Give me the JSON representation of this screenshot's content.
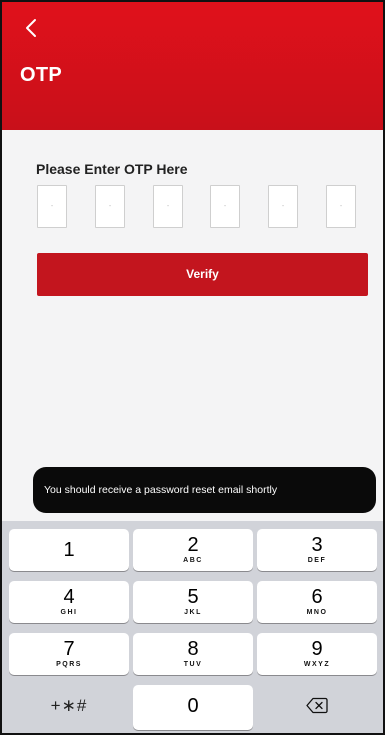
{
  "header": {
    "title": "OTP",
    "back_icon": "chevron-left-icon",
    "color": "#d4111b"
  },
  "otp": {
    "label": "Please Enter OTP Here",
    "digits": [
      "-",
      "-",
      "-",
      "-",
      "-",
      "-"
    ]
  },
  "verify": {
    "label": "Verify",
    "color": "#c3151e"
  },
  "toast": {
    "message": "You should receive a password reset email shortly"
  },
  "keypad": {
    "keys": [
      {
        "digit": "1",
        "letters": ""
      },
      {
        "digit": "2",
        "letters": "ABC"
      },
      {
        "digit": "3",
        "letters": "DEF"
      },
      {
        "digit": "4",
        "letters": "GHI"
      },
      {
        "digit": "5",
        "letters": "JKL"
      },
      {
        "digit": "6",
        "letters": "MNO"
      },
      {
        "digit": "7",
        "letters": "PQRS"
      },
      {
        "digit": "8",
        "letters": "TUV"
      },
      {
        "digit": "9",
        "letters": "WXYZ"
      }
    ],
    "symbols": "+∗#",
    "zero": "0",
    "delete_icon": "backspace-icon"
  }
}
